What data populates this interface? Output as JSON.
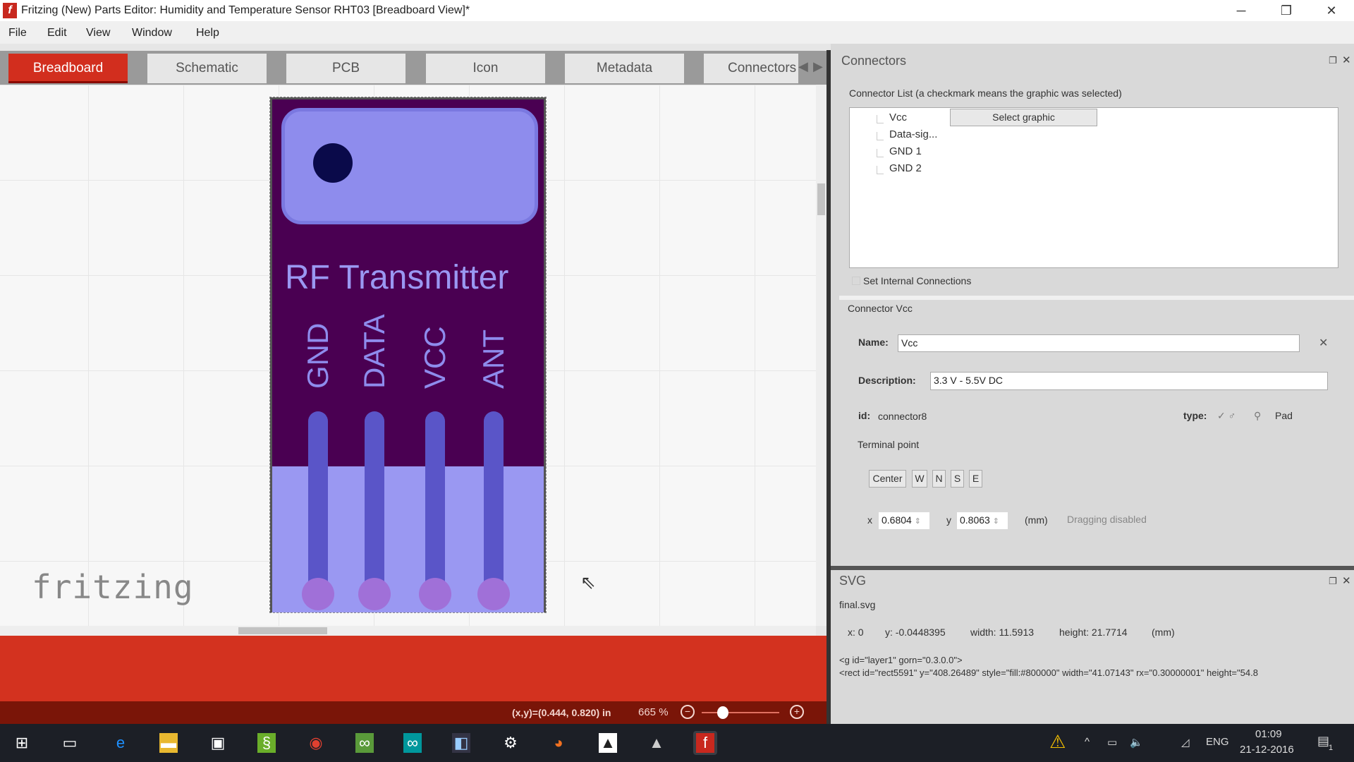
{
  "window": {
    "title": "Fritzing (New) Parts Editor: Humidity and Temperature Sensor RHT03 [Breadboard View]*",
    "app_icon": "f",
    "minimize": "─",
    "restore": "❐",
    "close": "✕"
  },
  "menu": [
    "File",
    "Edit",
    "View",
    "Window",
    "Help"
  ],
  "tabs": [
    {
      "label": "Breadboard",
      "active": true
    },
    {
      "label": "Schematic"
    },
    {
      "label": "PCB"
    },
    {
      "label": "Icon"
    },
    {
      "label": "Metadata"
    },
    {
      "label": "Connectors"
    }
  ],
  "canvas": {
    "part": {
      "title": "RF Transmitter",
      "pins": [
        "GND",
        "DATA",
        "VCC",
        "ANT"
      ],
      "colors": {
        "body": "#4a0052",
        "top": "#8e8ced",
        "lower": "#9a98f2",
        "pin": "#5a55c8",
        "pad": "#a070d8",
        "dot": "#0a0a4a"
      }
    },
    "logo": "fritzing"
  },
  "status": {
    "coords": "(x,y)=(0.444, 0.820) in",
    "zoom": "665 %",
    "zoom_level_percent": 665
  },
  "connectors_panel": {
    "title": "Connectors",
    "list_label": "Connector List (a checkmark means the graphic was selected)",
    "items": [
      "Vcc",
      "Data-sig...",
      "GND 1",
      "GND 2"
    ],
    "select_graphic": "Select graphic",
    "internal": "Set Internal Connections",
    "section": "Connector Vcc",
    "name_label": "Name:",
    "name_value": "Vcc",
    "desc_label": "Description:",
    "desc_value": "3.3 V - 5.5V DC",
    "id_label": "id:",
    "id_value": "connector8",
    "type_label": "type:",
    "type_pad": "Pad",
    "terminal_label": "Terminal point",
    "terminal_buttons": [
      "Center",
      "W",
      "N",
      "S",
      "E"
    ],
    "x_label": "x",
    "x_value": "0.6804",
    "y_label": "y",
    "y_value": "0.8063",
    "unit": "(mm)",
    "dragging": "Dragging disabled"
  },
  "svg_panel": {
    "title": "SVG",
    "file": "final.svg",
    "dims": {
      "x": "x: 0",
      "y": "y: -0.0448395",
      "width": "width: 11.5913",
      "height": "height: 21.7714",
      "unit": "(mm)"
    },
    "code": [
      "<g id=\"layer1\" gorn=\"0.3.0.0\">",
      "<rect id=\"rect5591\" y=\"408.26489\" style=\"fill:#800000\" width=\"41.07143\" rx=\"0.30000001\" height=\"54.8"
    ]
  },
  "taskbar": {
    "icons": [
      "windows-start",
      "task-view",
      "edge",
      "file-explorer",
      "store",
      "evernote",
      "chrome",
      "tripadvisor",
      "arduino",
      "app",
      "settings",
      "firefox",
      "photos",
      "inkscape",
      "fritzing"
    ],
    "tray": {
      "lang": "ENG",
      "time": "01:09",
      "date": "21-12-2016",
      "notifications": "1"
    }
  }
}
